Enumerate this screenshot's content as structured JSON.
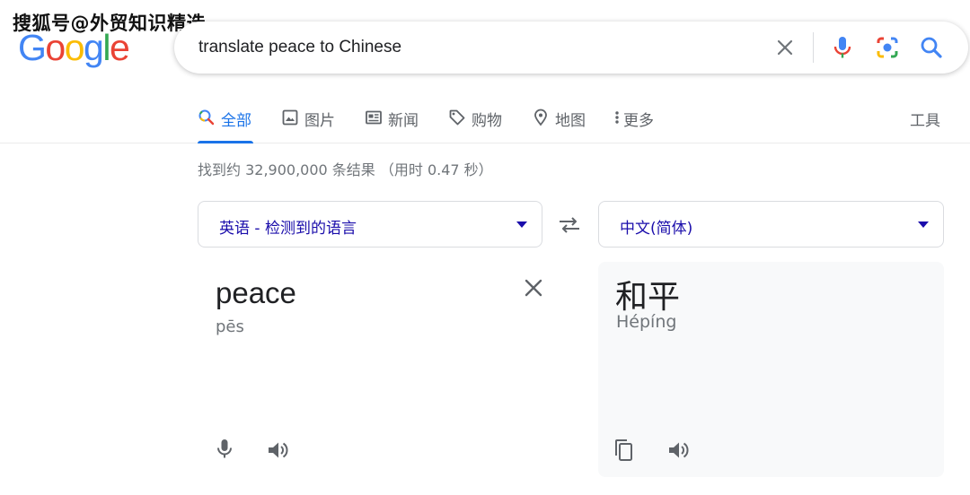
{
  "watermark": "搜狐号@外贸知识精选",
  "logo": {
    "letters": [
      "G",
      "o",
      "o",
      "g",
      "l",
      "e"
    ],
    "colors": [
      "#4285f4",
      "#ea4335",
      "#fbbc05",
      "#4285f4",
      "#34a853",
      "#ea4335"
    ]
  },
  "search": {
    "query": "translate peace to Chinese"
  },
  "tabs": [
    {
      "label": "全部",
      "icon": "search-icon",
      "active": true
    },
    {
      "label": "图片",
      "icon": "image-icon"
    },
    {
      "label": "新闻",
      "icon": "news-icon"
    },
    {
      "label": "购物",
      "icon": "tag-icon"
    },
    {
      "label": "地图",
      "icon": "map-pin-icon"
    },
    {
      "label": "更多",
      "icon": "more-vert-icon"
    }
  ],
  "tools_label": "工具",
  "result_stats": "找到约 32,900,000 条结果 （用时 0.47 秒）",
  "translator": {
    "source_lang": "英语 - 检测到的语言",
    "target_lang": "中文(简体)",
    "source_text": "peace",
    "source_pronunciation": "pēs",
    "target_text": "和平",
    "target_pronunciation": "Hépíng"
  },
  "colors": {
    "accent": "#1a73e8",
    "link": "#1a0dab",
    "muted": "#5f6368"
  }
}
